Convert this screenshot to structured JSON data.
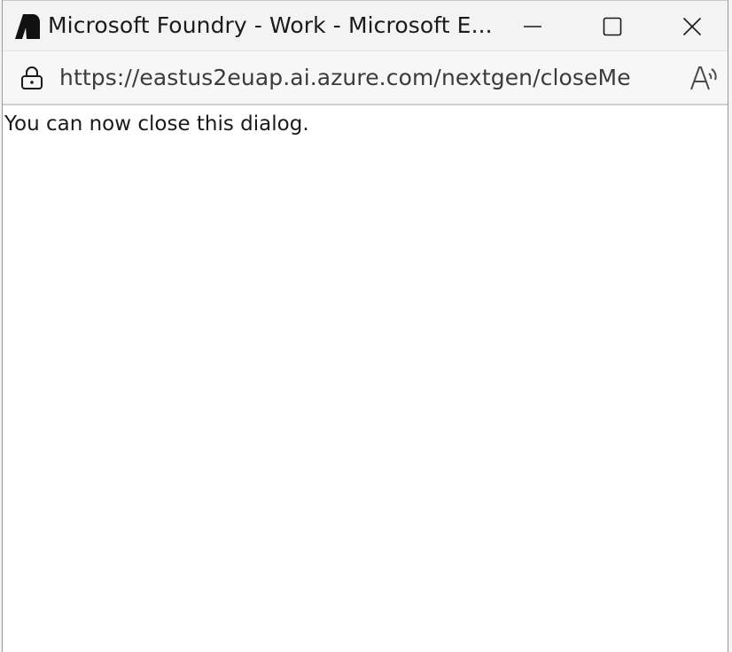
{
  "window": {
    "title": "Microsoft Foundry - Work - Microsoft E...",
    "logo_icon": "microsoft-foundry-logo-icon",
    "controls": {
      "minimize_icon": "minimize-icon",
      "maximize_icon": "maximize-icon",
      "close_icon": "close-icon"
    }
  },
  "address_bar": {
    "url": "https://eastus2euap.ai.azure.com/nextgen/closeMe",
    "lock_icon": "lock-icon",
    "read_aloud_icon": "read-aloud-icon"
  },
  "content": {
    "message": "You can now close this dialog."
  },
  "colors": {
    "titlebar_bg": "#f3f3f3",
    "content_bg": "#ffffff",
    "text": "#1a1a1a"
  }
}
